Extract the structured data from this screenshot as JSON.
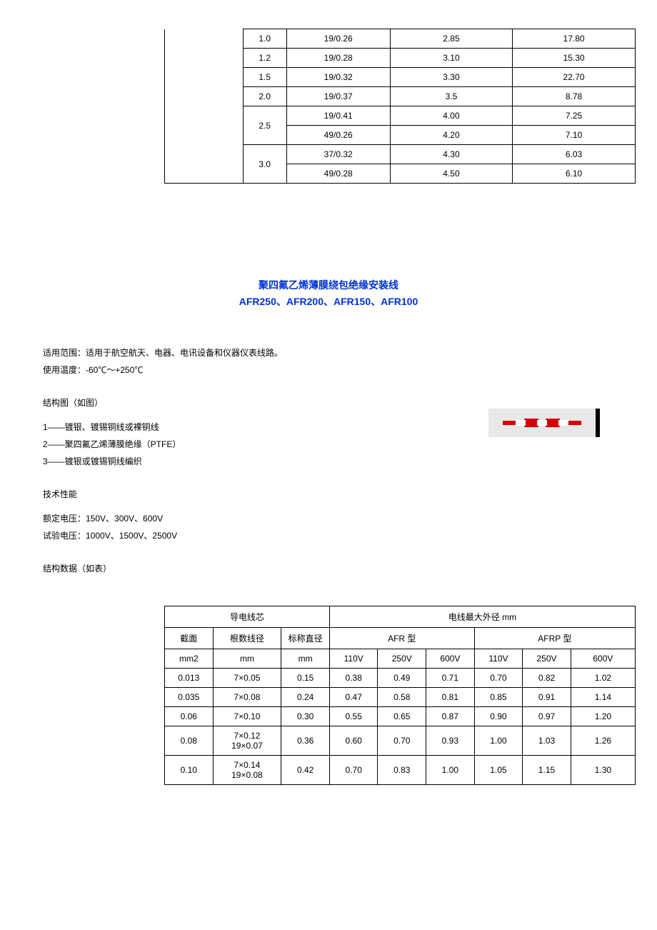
{
  "top_table": {
    "rows": [
      {
        "c1": "1.0",
        "c2": "19/0.26",
        "c3": "2.85",
        "c4": "17.80"
      },
      {
        "c1": "1.2",
        "c2": "19/0.28",
        "c3": "3.10",
        "c4": "15.30"
      },
      {
        "c1": "1.5",
        "c2": "19/0.32",
        "c3": "3.30",
        "c4": "22.70"
      },
      {
        "c1": "2.0",
        "c2": "19/0.37",
        "c3": "3.5",
        "c4": "8.78"
      },
      {
        "c1": "2.5",
        "c2": "19/0.41",
        "c3": "4.00",
        "c4": "7.25"
      },
      {
        "c1": "",
        "c2": "49/0.26",
        "c3": "4.20",
        "c4": "7.10"
      },
      {
        "c1": "3.0",
        "c2": "37/0.32",
        "c3": "4.30",
        "c4": "6.03"
      },
      {
        "c1": "",
        "c2": "49/0.28",
        "c3": "4.50",
        "c4": "6.10"
      }
    ]
  },
  "title": {
    "line1": "聚四氟乙烯薄膜绕包绝缘安装线",
    "line2": "AFR250、AFR200、AFR150、AFR100"
  },
  "intro": {
    "scope_label": "适用范围：适用于航空航天、电器、电讯设备和仪器仪表线路。",
    "temp_label": "使用温度：-60℃～+250℃"
  },
  "structure": {
    "heading": "结构图（如图）",
    "items": [
      "1——镀银、镀锡铜线或裸铜线",
      "2——聚四氟乙烯薄膜绝缘（PTFE）",
      "3——镀银或镀锡铜线编织"
    ]
  },
  "tech": {
    "heading": "技术性能",
    "rated": "额定电压：150V、300V、600V",
    "test": "试验电压：1000V、1500V、2500V"
  },
  "data_heading": "结构数据（如表）",
  "bottom_table": {
    "hdr_core": "导电线芯",
    "hdr_outer": "电线最大外径 mm",
    "hdr_section": "截面",
    "hdr_strand": "根数线径",
    "hdr_nominal": "标称直径",
    "hdr_afr": "AFR 型",
    "hdr_afrp": "AFRP 型",
    "unit_mm2": "mm2",
    "unit_mm": "mm",
    "v110": "110V",
    "v250": "250V",
    "v600": "600V",
    "rows": [
      {
        "sec": "0.013",
        "strand": "7×0.05",
        "nom": "0.15",
        "a110": "0.38",
        "a250": "0.49",
        "a600": "0.71",
        "p110": "0.70",
        "p250": "0.82",
        "p600": "1.02"
      },
      {
        "sec": "0.035",
        "strand": "7×0.08",
        "nom": "0.24",
        "a110": "0.47",
        "a250": "0.58",
        "a600": "0.81",
        "p110": "0.85",
        "p250": "0.91",
        "p600": "1.14"
      },
      {
        "sec": "0.06",
        "strand": "7×0.10",
        "nom": "0.30",
        "a110": "0.55",
        "a250": "0.65",
        "a600": "0.87",
        "p110": "0.90",
        "p250": "0.97",
        "p600": "1.20"
      },
      {
        "sec": "0.08",
        "strand": "7×0.12\n19×0.07",
        "nom": "0.36",
        "a110": "0.60",
        "a250": "0.70",
        "a600": "0.93",
        "p110": "1.00",
        "p250": "1.03",
        "p600": "1.26"
      },
      {
        "sec": "0.10",
        "strand": "7×0.14\n19×0.08",
        "nom": "0.42",
        "a110": "0.70",
        "a250": "0.83",
        "a600": "1.00",
        "p110": "1.05",
        "p250": "1.15",
        "p600": "1.30"
      }
    ]
  }
}
